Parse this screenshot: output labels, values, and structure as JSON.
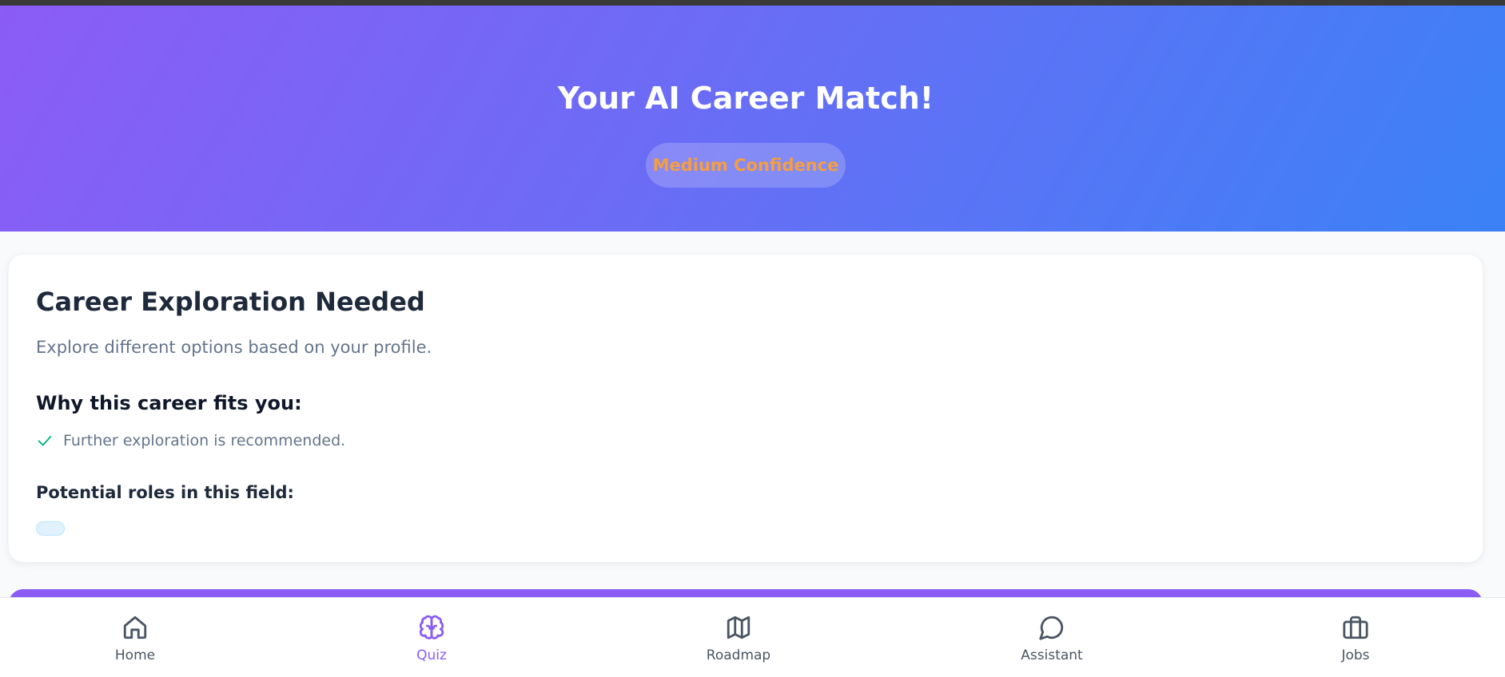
{
  "hero": {
    "title": "Your AI Career Match!",
    "confidence": "Medium Confidence"
  },
  "result": {
    "title": "Career Exploration Needed",
    "description": "Explore different options based on your profile.",
    "why_heading": "Why this career fits you:",
    "reasons": [
      "Further exploration is recommended."
    ],
    "roles_heading": "Potential roles in this field:",
    "roles": [
      ""
    ]
  },
  "nav": {
    "items": [
      {
        "label": "Home",
        "icon": "home-icon"
      },
      {
        "label": "Quiz",
        "icon": "brain-icon",
        "active": true
      },
      {
        "label": "Roadmap",
        "icon": "map-icon"
      },
      {
        "label": "Assistant",
        "icon": "chat-bubble-icon"
      },
      {
        "label": "Jobs",
        "icon": "briefcase-icon"
      }
    ]
  },
  "colors": {
    "accent": "#8b5cf6",
    "gradient_start": "#8b5cf6",
    "gradient_end": "#3b82f6",
    "confidence_text": "#f59e42",
    "check": "#10b981"
  }
}
